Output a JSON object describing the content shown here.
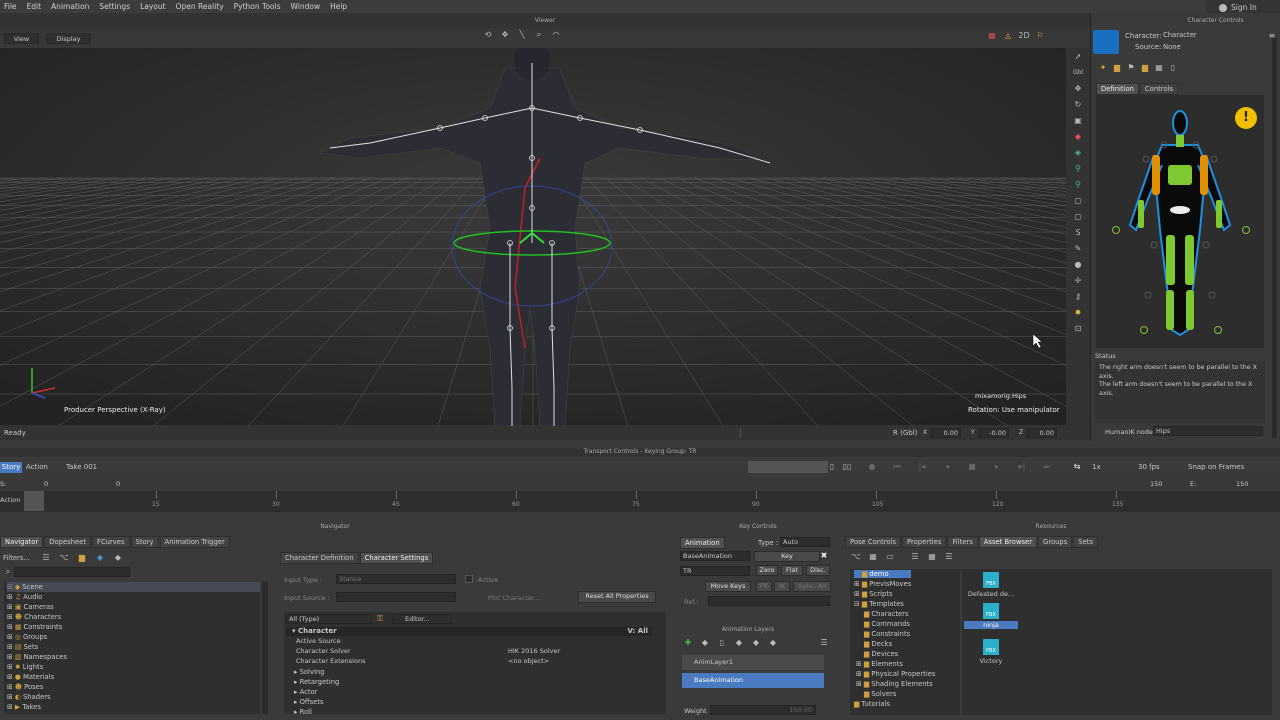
{
  "menubar": {
    "items": [
      "File",
      "Edit",
      "Animation",
      "Settings",
      "Layout",
      "Open Reality",
      "Python Tools",
      "Window",
      "Help"
    ],
    "sign_in": "Sign In"
  },
  "viewer": {
    "title": "Viewer",
    "view_menu": "View",
    "display_menu": "Display",
    "camera_label": "Producer Perspective (X-Ray)",
    "selected_node": "mixamorig:Hips",
    "manip_mode": "Rotation: Use manipulator",
    "status": "Ready",
    "rotation_label": "R (Gbl)",
    "x_val": "0.00",
    "y_val": "-0.00",
    "z_val": "0.00"
  },
  "character_controls": {
    "title": "Character Controls",
    "character_label": "Character:",
    "character_value": "Character",
    "source_label": "Source:",
    "source_value": "None",
    "tabs": [
      "Definition",
      "Controls"
    ],
    "status_heading": "Status",
    "status_lines": [
      "The right arm doesn't seem to be parallel to the X axis.",
      "The left arm doesn't seem to be parallel to the X axis."
    ],
    "humanik_label": "HumanIK node:",
    "humanik_value": "Hips"
  },
  "transport": {
    "title": "Transport Controls  -  Keying Group: TR",
    "story_tab": "Story",
    "action_tab": "Action",
    "take": "Take 001",
    "speed": "1x",
    "fps": "30 fps",
    "snap": "Snap on Frames",
    "start_label": "S:",
    "start_value": "0",
    "end_label": "E:",
    "end_value": "150",
    "current_frame": "0",
    "ruler_end": "150",
    "ruler_ticks": [
      "15",
      "30",
      "45",
      "60",
      "75",
      "90",
      "105",
      "120",
      "135"
    ],
    "ruler_tick_values": [
      15,
      30,
      45,
      60,
      75,
      90,
      105,
      120,
      135
    ],
    "action_label": "Action"
  },
  "navigator": {
    "title": "Navigator",
    "tabs": [
      "Navigator",
      "Dopesheet",
      "FCurves",
      "Story",
      "Animation Trigger"
    ],
    "filters_label": "Filters...",
    "tree": [
      "Scene",
      "Audio",
      "Cameras",
      "Characters",
      "Constraints",
      "Groups",
      "Sets",
      "Namespaces",
      "Lights",
      "Materials",
      "Poses",
      "Shaders",
      "Takes"
    ],
    "char_tabs": [
      "Character Definition",
      "Character Settings"
    ],
    "input_type_label": "Input Type :",
    "input_type_value": "Stance",
    "active_label": "Active",
    "input_source_label": "Input Source :",
    "plot_character": "Plot Character...",
    "reset_all": "Reset All Properties",
    "filter_type": "All (Type)",
    "editor_btn": "Editor...",
    "section": "Character",
    "section_view": "V: All",
    "props": [
      {
        "name": "Active Source",
        "value": ""
      },
      {
        "name": "Character Solver",
        "value": "HIK 2016 Solver"
      },
      {
        "name": "Character Extensions",
        "value": "<no object>"
      }
    ],
    "groups": [
      "Solving",
      "Retargeting",
      "Actor",
      "Offsets",
      "Roll"
    ]
  },
  "key_controls": {
    "title": "Key Controls",
    "animation_tab": "Animation",
    "type_label": "Type :",
    "type_value": "Auto",
    "layer_value": "BaseAnimation",
    "key_btn": "Key",
    "tr_value": "TR",
    "zero_btn": "Zero",
    "flat_btn": "Flat",
    "disc_btn": "Disc.",
    "move_keys": "Move Keys",
    "fk_btn": "FK",
    "ik_btn": "IK",
    "sync_btn": "Sync. All",
    "ref_label": "Ref.:",
    "layers_title": "Animation Layers",
    "layers": [
      "AnimLayer1",
      "BaseAnimation"
    ],
    "weight_label": "Weight",
    "weight_value": "100.00"
  },
  "resources": {
    "title": "Resources",
    "tabs": [
      "Pose Controls",
      "Properties",
      "Filters",
      "Asset Browser",
      "Groups",
      "Sets"
    ],
    "tree": [
      "demo",
      "PrevisMoves",
      "Scripts",
      "Templates",
      "Characters",
      "Commands",
      "Constraints",
      "Decks",
      "Devices",
      "Elements",
      "Physical Properties",
      "Shading Elements",
      "Solvers",
      "Tutorials"
    ],
    "assets": [
      "Defeated de...",
      "ninja",
      "Victory"
    ],
    "asset_badge": "FBX"
  },
  "colors": {
    "accent": "#4a90d0",
    "warning": "#f0c000",
    "figure_green": "#7ec832",
    "figure_orange": "#e09000"
  }
}
